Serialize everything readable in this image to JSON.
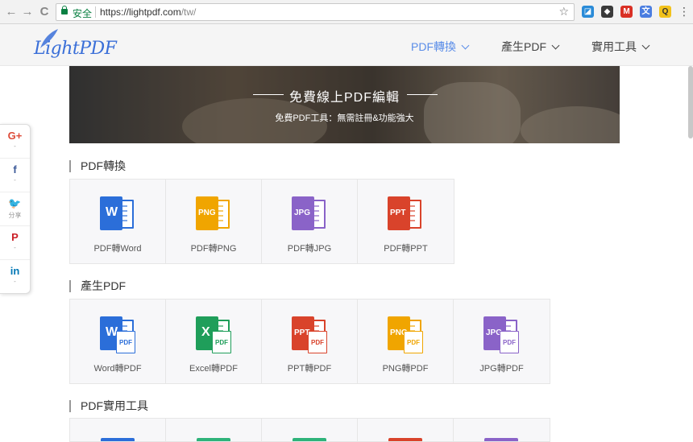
{
  "browser": {
    "back": "←",
    "forward": "→",
    "reload": "C",
    "secure_label": "安全",
    "url_host": "https://lightpdf.com",
    "url_path": "/tw/",
    "bookmark": "☆",
    "extensions": [
      {
        "name": "ext-blue",
        "glyph": "◪",
        "color": "#2a8bd8"
      },
      {
        "name": "ext-evernote",
        "glyph": "◆",
        "color": "#3a3a3a"
      },
      {
        "name": "ext-gmail",
        "glyph": "M",
        "color": "#d93025"
      },
      {
        "name": "ext-translate",
        "glyph": "文",
        "color": "#4a7de0"
      },
      {
        "name": "ext-q",
        "glyph": "Q",
        "color": "#f2c21b"
      }
    ],
    "menu": "⋮"
  },
  "header": {
    "logo_text": "LightPDF",
    "nav": [
      {
        "label": "PDF轉換",
        "active": true
      },
      {
        "label": "產生PDF",
        "active": false
      },
      {
        "label": "實用工具",
        "active": false
      }
    ]
  },
  "banner": {
    "title": "免費線上PDF編輯",
    "subtitle": "免費PDF工具：無需註冊&功能強大"
  },
  "share": [
    {
      "icon": "google-plus-icon",
      "glyph": "G+",
      "color": "#dd4b39",
      "count": "-"
    },
    {
      "icon": "facebook-icon",
      "glyph": "f",
      "color": "#3b5998",
      "count": "-"
    },
    {
      "icon": "twitter-icon",
      "glyph": "🐦",
      "color": "#1da1f2",
      "count": "分享"
    },
    {
      "icon": "pinterest-icon",
      "glyph": "P",
      "color": "#cb2027",
      "count": "-"
    },
    {
      "icon": "linkedin-icon",
      "glyph": "in",
      "color": "#0077b5",
      "count": "-"
    }
  ],
  "sections": [
    {
      "title": "PDF轉換",
      "tools": [
        {
          "label": "PDF轉Word",
          "tag": "W",
          "color": "#2b6ed9",
          "accent": "#2b6ed9"
        },
        {
          "label": "PDF轉PNG",
          "tag": "PNG",
          "color": "#f0a500",
          "accent": "#f0a500"
        },
        {
          "label": "PDF轉JPG",
          "tag": "JPG",
          "color": "#8a63c8",
          "accent": "#8a63c8"
        },
        {
          "label": "PDF轉PPT",
          "tag": "PPT",
          "color": "#d9432b",
          "accent": "#d9432b"
        }
      ]
    },
    {
      "title": "產生PDF",
      "tools": [
        {
          "label": "Word轉PDF",
          "tag": "W",
          "color": "#2b6ed9",
          "pdf": "PDF"
        },
        {
          "label": "Excel轉PDF",
          "tag": "X",
          "color": "#1f9e5a",
          "pdf": "PDF"
        },
        {
          "label": "PPT轉PDF",
          "tag": "PPT",
          "color": "#d9432b",
          "pdf": "PDF"
        },
        {
          "label": "PNG轉PDF",
          "tag": "PNG",
          "color": "#f0a500",
          "pdf": "PDF"
        },
        {
          "label": "JPG轉PDF",
          "tag": "JPG",
          "color": "#8a63c8",
          "pdf": "PDF"
        }
      ]
    },
    {
      "title": "PDF實用工具",
      "stub_colors": [
        "#2b6ed9",
        "#2eb37a",
        "#2eb37a",
        "#d9432b",
        "#8a63c8"
      ]
    }
  ]
}
